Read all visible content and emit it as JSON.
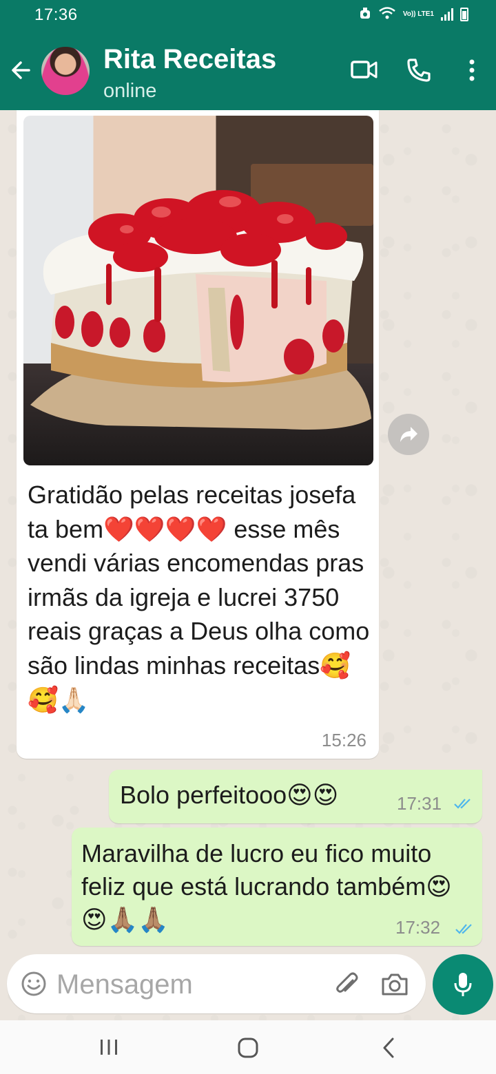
{
  "status_bar": {
    "time": "17:36",
    "network_label": "Vo)) LTE1"
  },
  "header": {
    "contact_name": "Rita Receitas",
    "contact_status": "online",
    "accent_color": "#0a7a66"
  },
  "messages": [
    {
      "direction": "incoming",
      "has_image": true,
      "image_subject": "strawberry cake",
      "text": "Gratidão pelas receitas josefa ta bem❤️❤️❤️❤️ esse mês vendi várias encomendas pras irmãs da igreja e lucrei 3750 reais graças a Deus olha como são lindas minhas receitas🥰🥰🙏🏻",
      "time": "15:26"
    },
    {
      "direction": "outgoing",
      "text": "Bolo perfeitooo😍😍",
      "time": "17:31",
      "read": true
    },
    {
      "direction": "outgoing",
      "text": "Maravilha de lucro eu fico muito feliz que está lucrando também😍😍🙏🏽🙏🏽",
      "time": "17:32",
      "read": true
    }
  ],
  "composer": {
    "placeholder": "Mensagem"
  },
  "colors": {
    "incoming_bubble": "#ffffff",
    "outgoing_bubble": "#dcf7c5",
    "read_ticks": "#4fb6ec",
    "mic_button": "#0a8a73"
  }
}
